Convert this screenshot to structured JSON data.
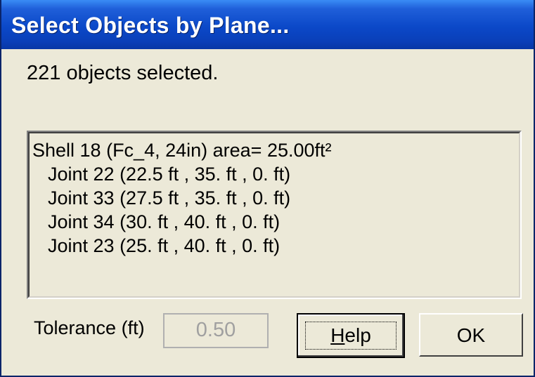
{
  "window": {
    "title": "Select Objects by Plane..."
  },
  "status": {
    "text": "221 objects selected."
  },
  "list": {
    "lines": [
      "Shell 18 (Fc_4, 24in) area= 25.00ft²",
      "Joint 22 (22.5 ft , 35. ft , 0. ft)",
      "Joint 33 (27.5 ft , 35. ft , 0. ft)",
      "Joint 34 (30. ft , 40. ft , 0. ft)",
      "Joint 23 (25. ft , 40. ft , 0. ft)"
    ]
  },
  "tolerance": {
    "label": "Tolerance (ft)",
    "value": "0.50"
  },
  "buttons": {
    "help_mnemonic": "H",
    "help_rest": "elp",
    "ok_label": "OK"
  }
}
